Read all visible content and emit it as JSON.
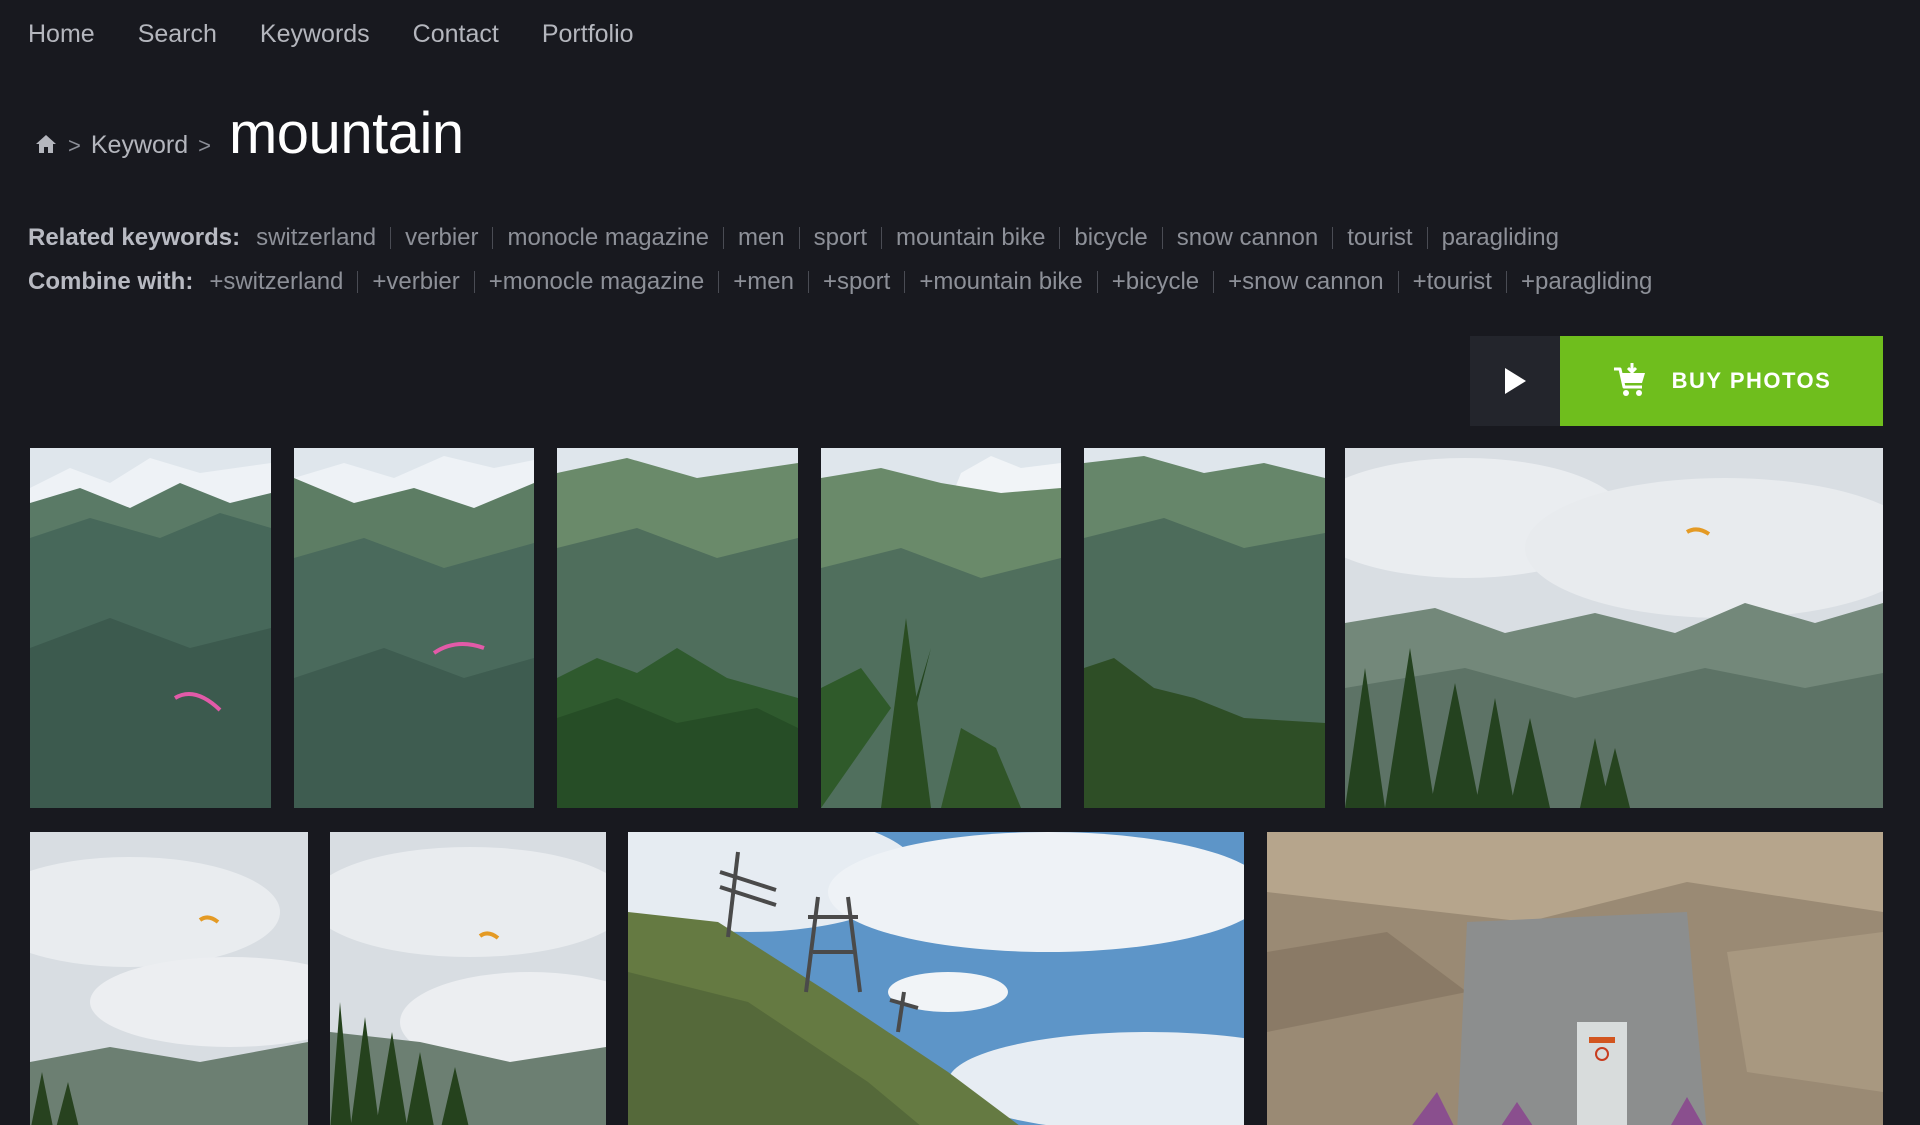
{
  "nav": {
    "home": "Home",
    "search": "Search",
    "keywords": "Keywords",
    "contact": "Contact",
    "portfolio": "Portfolio"
  },
  "breadcrumb": {
    "home_icon": "home-icon",
    "separator": ">",
    "keyword_link": "Keyword",
    "title": "mountain"
  },
  "related": {
    "label": "Related keywords:",
    "items": [
      "switzerland",
      "verbier",
      "monocle magazine",
      "men",
      "sport",
      "mountain bike",
      "bicycle",
      "snow cannon",
      "tourist",
      "paragliding"
    ]
  },
  "combine": {
    "label": "Combine with:",
    "items": [
      "+switzerland",
      "+verbier",
      "+monocle magazine",
      "+men",
      "+sport",
      "+mountain bike",
      "+bicycle",
      "+snow cannon",
      "+tourist",
      "+paragliding"
    ]
  },
  "actions": {
    "play_icon": "play-icon",
    "buy_icon": "shopping-cart-icon",
    "buy_label": "BUY PHOTOS"
  },
  "colors": {
    "background": "#18191f",
    "accent_green": "#6fbe1d",
    "button_dark": "#23252c"
  }
}
